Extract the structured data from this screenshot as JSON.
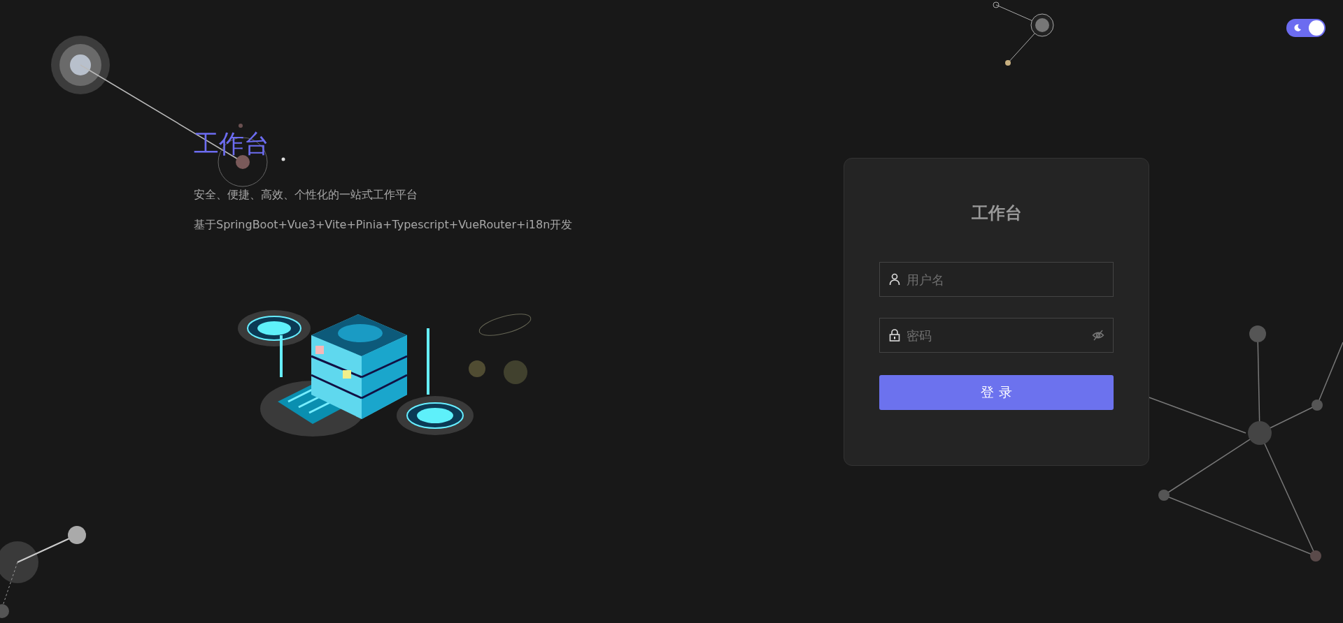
{
  "theme_toggle": {
    "on": true
  },
  "hero": {
    "title": "工作台",
    "tagline": "安全、便捷、高效、个性化的一站式工作平台",
    "tech": "基于SpringBoot+Vue3+Vite+Pinia+Typescript+VueRouter+i18n开发"
  },
  "login": {
    "title": "工作台",
    "username": {
      "placeholder": "用户名"
    },
    "password": {
      "placeholder": "密码",
      "visible": false
    },
    "submit": "登 录"
  }
}
